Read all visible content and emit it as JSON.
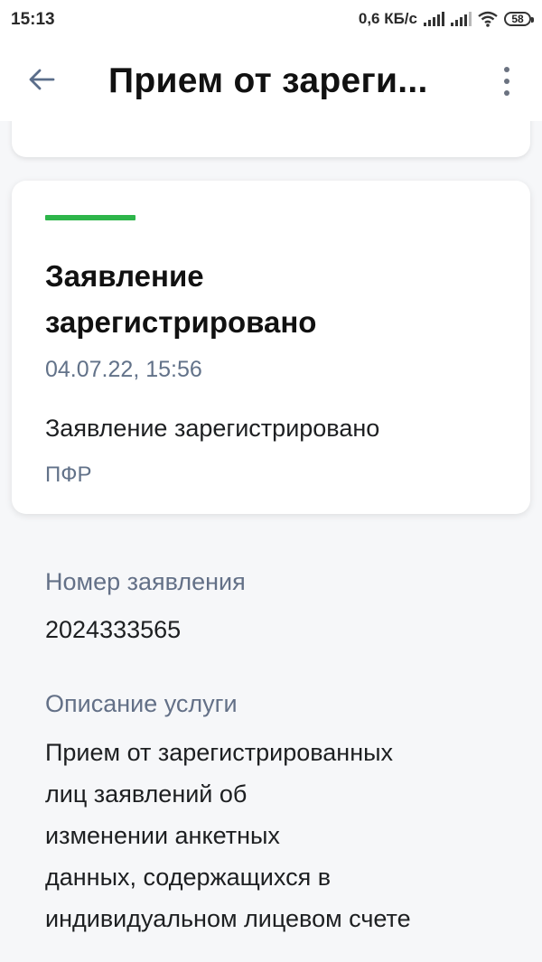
{
  "status_bar": {
    "time": "15:13",
    "net_speed": "0,6 КБ/с",
    "battery": "58"
  },
  "app_bar": {
    "back_icon": "arrow-left-icon",
    "title": "Прием от зареги...",
    "menu_icon": "more-vertical-icon"
  },
  "status_card": {
    "accent_color": "#2db54a",
    "title_line1": "Заявление",
    "title_line2": "зарегистрировано",
    "date": "04.07.22, 15:56",
    "message": "Заявление зарегистрировано",
    "org": "ПФР"
  },
  "details": {
    "number_label": "Номер заявления",
    "number_value": "2024333565",
    "description_label": "Описание услуги",
    "description_lines": [
      "Прием от зарегистрированных",
      "лиц заявлений об",
      "изменении анкетных",
      "данных, содержащихся в",
      "индивидуальном лицевом счете"
    ]
  }
}
